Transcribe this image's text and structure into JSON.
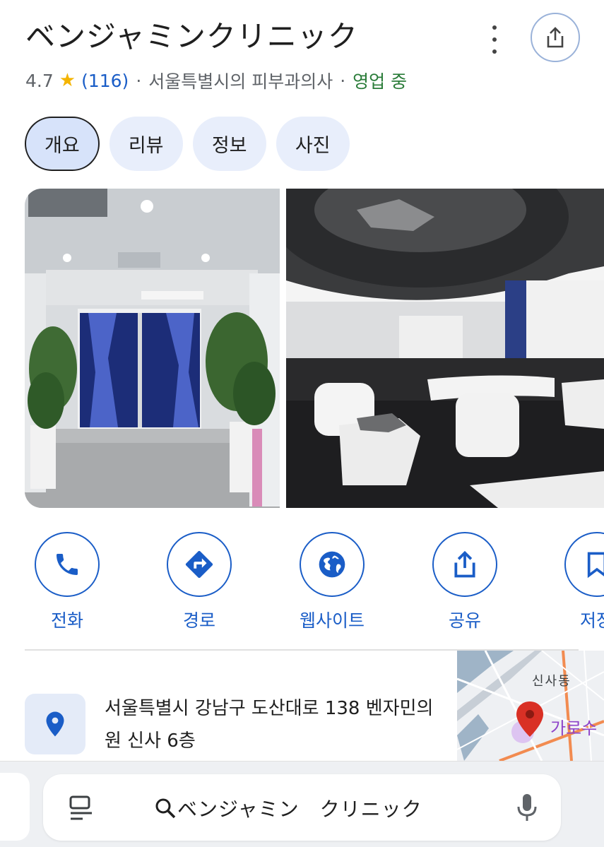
{
  "place": {
    "title": "ベンジャミンクリニック",
    "rating": "4.7",
    "review_count": "(116)",
    "category": "서울특별시의 피부과의사",
    "status": "영업 중",
    "separator": "·"
  },
  "tabs": [
    {
      "label": "개요",
      "active": true
    },
    {
      "label": "리뷰",
      "active": false
    },
    {
      "label": "정보",
      "active": false
    },
    {
      "label": "사진",
      "active": false
    }
  ],
  "actions": [
    {
      "label": "전화",
      "icon": "phone-icon"
    },
    {
      "label": "경로",
      "icon": "directions-icon"
    },
    {
      "label": "웹사이트",
      "icon": "globe-icon"
    },
    {
      "label": "공유",
      "icon": "share-icon"
    },
    {
      "label": "저장",
      "icon": "bookmark-icon"
    }
  ],
  "address": "서울특별시 강남구 도산대로 138 벤자민의원 신사 6층",
  "map": {
    "district": "신사동",
    "street": "가로수"
  },
  "search": {
    "query": "ベンジャミン　クリニック"
  },
  "colors": {
    "accent": "#1a5dc7",
    "open": "#2a7c39",
    "star": "#f4b400",
    "tab_bg": "#e8eefb",
    "map_pin": "#d93025"
  }
}
